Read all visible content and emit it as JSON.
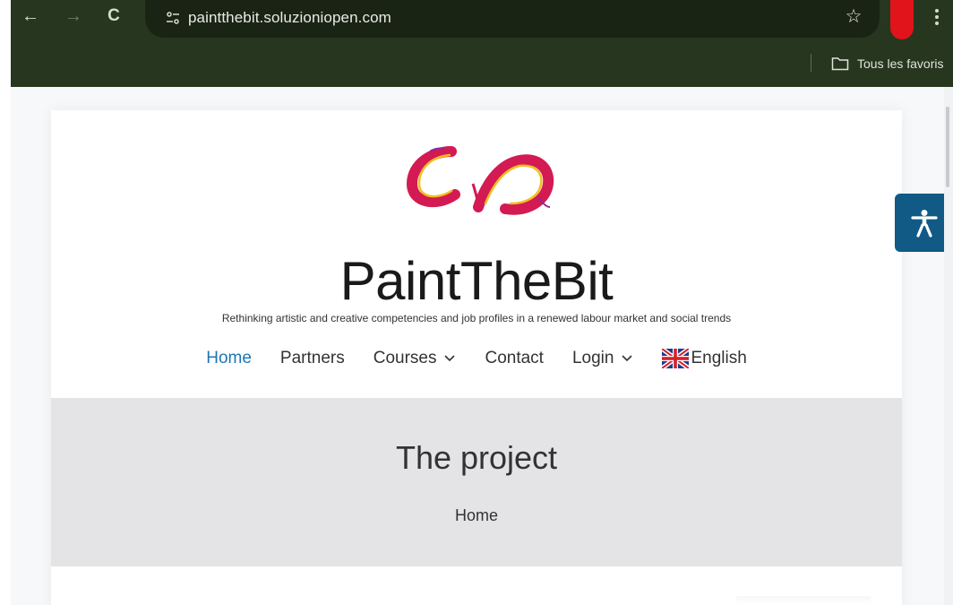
{
  "browser": {
    "url": "paintthebit.soluzioniopen.com",
    "back_glyph": "←",
    "forward_glyph": "→",
    "reload_glyph": "C",
    "bookmark_star_glyph": "☆",
    "bookmarks_folder_label": "Tous les favoris",
    "theme_color": "#27371f"
  },
  "site": {
    "title": "PaintTheBit",
    "tagline": "Rethinking artistic and creative competencies and job profiles in a renewed labour market and social trends"
  },
  "menu": {
    "items": [
      {
        "label": "Home",
        "active": true
      },
      {
        "label": "Partners"
      },
      {
        "label": "Courses",
        "dropdown": true
      },
      {
        "label": "Contact"
      },
      {
        "label": "Login",
        "dropdown": true
      },
      {
        "label": "English",
        "icon": "uk-flag-icon"
      }
    ],
    "active_color": "#1e76b5"
  },
  "hero": {
    "title": "The project",
    "breadcrumb": "Home"
  },
  "accessibility": {
    "icon": "accessibility-icon",
    "color": "#105a85"
  }
}
